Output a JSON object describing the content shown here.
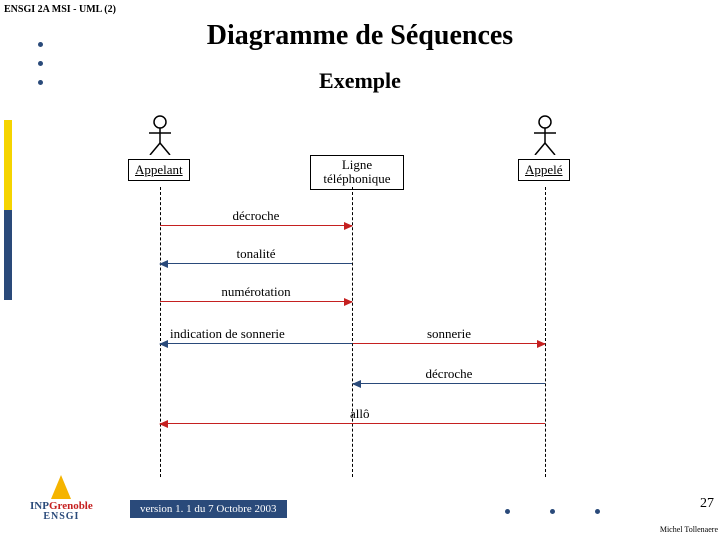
{
  "header": "ENSGI 2A MSI - UML (2)",
  "title": "Diagramme de Séquences",
  "subtitle": "Exemple",
  "participants": {
    "caller": "Appelant",
    "line": "Ligne téléphonique",
    "callee": "Appelé"
  },
  "messages": {
    "m1": "décroche",
    "m2": "tonalité",
    "m3": "numérotation",
    "m4": "indication de sonnerie",
    "m5": "sonnerie",
    "m6": "décroche",
    "m7": "allô"
  },
  "footer": {
    "version": "version 1. 1 du 7 Octobre 2003",
    "page": "27",
    "author": "Michel Tollenaere",
    "logo_top": "INP",
    "logo_top2": "Grenoble",
    "logo_bottom": "ENSGI"
  }
}
